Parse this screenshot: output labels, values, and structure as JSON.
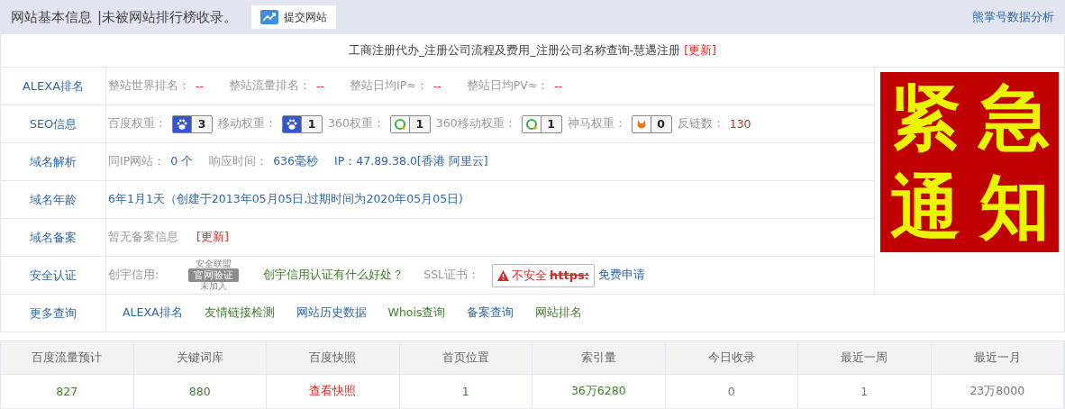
{
  "header": {
    "title": "网站基本信息",
    "subtitle": "|未被网站排行榜收录。",
    "submit_button": "提交网站",
    "right_link": "熊掌号数据分析"
  },
  "site_title": {
    "text": "工商注册代办_注册公司流程及费用_注册公司名称查询-慧遇注册",
    "update": "[更新]"
  },
  "rows": [
    {
      "label": "ALEXA排名",
      "parts": [
        {
          "kind": "label",
          "text": "整站世界排名："
        },
        {
          "kind": "dash",
          "text": "--"
        },
        {
          "kind": "label",
          "text": "整站流量排名："
        },
        {
          "kind": "dash",
          "text": "--"
        },
        {
          "kind": "label",
          "text": "整站日均IP≈："
        },
        {
          "kind": "dash",
          "text": "--"
        },
        {
          "kind": "label",
          "text": "整站日均PV≈："
        },
        {
          "kind": "dash",
          "text": "--"
        }
      ]
    },
    {
      "label": "SEO信息",
      "parts": [
        {
          "kind": "label",
          "text": "百度权重："
        },
        {
          "kind": "paw-badge",
          "text": "3"
        },
        {
          "kind": "label",
          "text": "移动权重："
        },
        {
          "kind": "paw-badge",
          "text": "1"
        },
        {
          "kind": "label",
          "text": "360权重："
        },
        {
          "kind": "ring-badge",
          "text": "1"
        },
        {
          "kind": "label",
          "text": "360移动权重："
        },
        {
          "kind": "ring-badge",
          "text": "1"
        },
        {
          "kind": "label",
          "text": "神马权重："
        },
        {
          "kind": "fox-badge",
          "text": "0"
        },
        {
          "kind": "label",
          "text": "反链数："
        },
        {
          "kind": "number",
          "text": "130"
        }
      ]
    },
    {
      "label": "域名解析",
      "parts": [
        {
          "kind": "label",
          "text": "同IP网站："
        },
        {
          "kind": "value",
          "text": "0 个"
        },
        {
          "kind": "label",
          "text": "响应时间："
        },
        {
          "kind": "value",
          "text": "636毫秒"
        },
        {
          "kind": "value",
          "text": "IP：47.89.38.0[香港 阿里云]"
        }
      ]
    },
    {
      "label": "域名年龄",
      "parts": [
        {
          "kind": "value",
          "text": "6年1月1天（创建于2013年05月05日,过期时间为2020年05月05日)"
        }
      ]
    },
    {
      "label": "域名备案",
      "parts": [
        {
          "kind": "label",
          "text": "暂无备案信息"
        },
        {
          "kind": "update",
          "text": "[更新]"
        }
      ]
    },
    {
      "label": "安全认证",
      "parts": [
        {
          "kind": "label",
          "text": "创宇信用:"
        },
        {
          "kind": "seal",
          "top": "安全联盟",
          "main": "官网验证",
          "bottom": "未加入"
        },
        {
          "kind": "green-link",
          "text": "创宇信用认证有什么好处？"
        },
        {
          "kind": "label",
          "text": "SSL证书："
        },
        {
          "kind": "ssl",
          "text": "不安全",
          "protocol": "https:"
        },
        {
          "kind": "blue-link",
          "text": "免费申请"
        }
      ]
    }
  ],
  "notice": {
    "characters": [
      "紧",
      "急",
      "通",
      "知"
    ]
  },
  "more": {
    "label": "更多查询",
    "links": [
      {
        "text": "ALEXA排名",
        "kind": "blue-link"
      },
      {
        "text": "友情链接检测",
        "kind": "green-link"
      },
      {
        "text": "网站历史数据",
        "kind": "blue-link"
      },
      {
        "text": "Whois查询",
        "kind": "green-link"
      },
      {
        "text": "备案查询",
        "kind": "blue-link"
      },
      {
        "text": "网站排名",
        "kind": "green-link"
      }
    ]
  },
  "stats": {
    "columns": [
      "百度流量预计",
      "关键词库",
      "百度快照",
      "首页位置",
      "索引量",
      "今日收录",
      "最近一周",
      "最近一月"
    ],
    "values": [
      {
        "text": "827",
        "kind": "count"
      },
      {
        "text": "880",
        "kind": "count"
      },
      {
        "text": "查看快照",
        "kind": "link"
      },
      {
        "text": "1",
        "kind": "count"
      },
      {
        "text": "36万6280",
        "kind": "count"
      },
      {
        "text": "0",
        "kind": "plain"
      },
      {
        "text": "1",
        "kind": "plain"
      },
      {
        "text": "23万8000",
        "kind": "plain"
      }
    ]
  }
}
